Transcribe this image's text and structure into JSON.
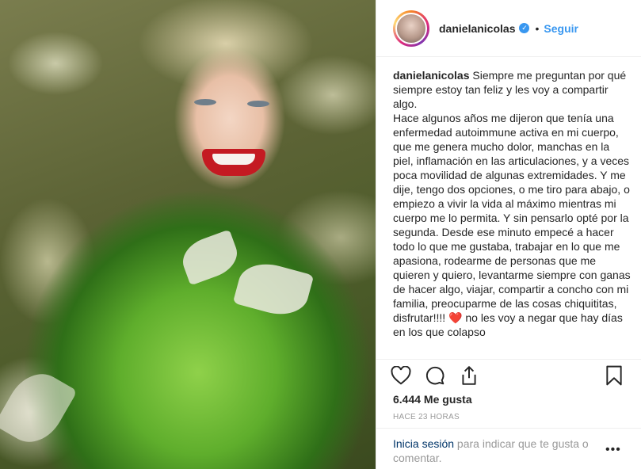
{
  "post": {
    "username": "danielanicolas",
    "follow_label": "Seguir",
    "separator": "•",
    "caption_user": "danielanicolas",
    "caption_part1": " Siempre me preguntan por qué siempre estoy tan feliz y les voy a compartir algo.",
    "caption_part2": "Hace algunos años me dijeron que tenía una enfermedad autoimmune activa en mi cuerpo, que me genera mucho dolor, manchas en la piel, inflamación en las articulaciones, y a veces poca movilidad de algunas extremidades. Y me dije, tengo dos opciones, o me tiro para abajo, o empiezo a vivir la vida al máximo mientras mi cuerpo me lo permita. Y sin pensarlo opté por la segunda. Desde ese minuto empecé a hacer todo lo que me gustaba, trabajar en lo que me apasiona, rodearme de personas que me quieren y quiero, levantarme siempre con ganas de hacer algo, viajar, compartir a concho con mi familia, preocuparme de las cosas chiquititas, disfrutar!!!! ",
    "caption_heart": "❤️",
    "caption_part3": " no les voy a negar que hay días en los que colapso",
    "likes": "6.444 Me gusta",
    "timestamp": "HACE 23 HORAS"
  },
  "login": {
    "link_label": "Inicia sesión",
    "rest_text": " para indicar que te gusta o comentar.",
    "more_label": "•••"
  },
  "icons": {
    "verified": "verified-badge-icon",
    "like": "heart-icon",
    "comment": "comment-icon",
    "share": "share-icon",
    "save": "bookmark-icon",
    "more": "more-options-icon"
  },
  "colors": {
    "accent": "#3897f0",
    "text": "#262626",
    "muted": "#999999",
    "heart": "#e21b2b",
    "link_dark": "#003569"
  }
}
